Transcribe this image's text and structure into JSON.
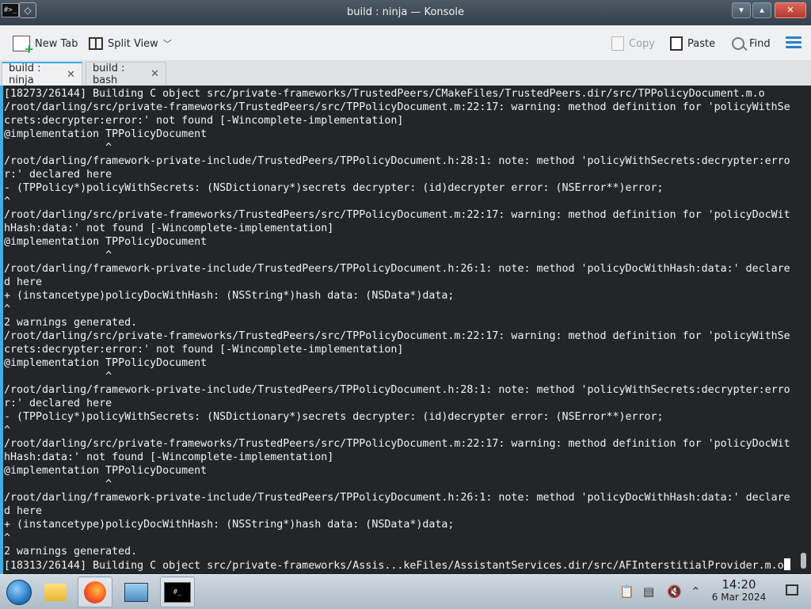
{
  "window": {
    "title": "build : ninja — Konsole",
    "app_icon_text": "#>_",
    "controls": {
      "minimize": "▾",
      "maximize": "▴",
      "close": "✕"
    }
  },
  "toolbar": {
    "new_tab": "New Tab",
    "split_view": "Split View",
    "copy": "Copy",
    "paste": "Paste",
    "find": "Find"
  },
  "tabs": [
    {
      "label": "build : ninja",
      "active": true
    },
    {
      "label": "build : bash",
      "active": false
    }
  ],
  "terminal": {
    "lines": [
      "[18273/26144] Building C object src/private-frameworks/TrustedPeers/CMakeFiles/TrustedPeers.dir/src/TPPolicyDocument.m.o",
      "/root/darling/src/private-frameworks/TrustedPeers/src/TPPolicyDocument.m:22:17: warning: method definition for 'policyWithSe",
      "crets:decrypter:error:' not found [-Wincomplete-implementation]",
      "@implementation TPPolicyDocument",
      "                ^",
      "/root/darling/framework-private-include/TrustedPeers/TPPolicyDocument.h:28:1: note: method 'policyWithSecrets:decrypter:erro",
      "r:' declared here",
      "- (TPPolicy*)policyWithSecrets: (NSDictionary*)secrets decrypter: (id)decrypter error: (NSError**)error;",
      "^",
      "/root/darling/src/private-frameworks/TrustedPeers/src/TPPolicyDocument.m:22:17: warning: method definition for 'policyDocWit",
      "hHash:data:' not found [-Wincomplete-implementation]",
      "@implementation TPPolicyDocument",
      "                ^",
      "/root/darling/framework-private-include/TrustedPeers/TPPolicyDocument.h:26:1: note: method 'policyDocWithHash:data:' declare",
      "d here",
      "+ (instancetype)policyDocWithHash: (NSString*)hash data: (NSData*)data;",
      "^",
      "2 warnings generated.",
      "/root/darling/src/private-frameworks/TrustedPeers/src/TPPolicyDocument.m:22:17: warning: method definition for 'policyWithSe",
      "crets:decrypter:error:' not found [-Wincomplete-implementation]",
      "@implementation TPPolicyDocument",
      "                ^",
      "/root/darling/framework-private-include/TrustedPeers/TPPolicyDocument.h:28:1: note: method 'policyWithSecrets:decrypter:erro",
      "r:' declared here",
      "- (TPPolicy*)policyWithSecrets: (NSDictionary*)secrets decrypter: (id)decrypter error: (NSError**)error;",
      "^",
      "/root/darling/src/private-frameworks/TrustedPeers/src/TPPolicyDocument.m:22:17: warning: method definition for 'policyDocWit",
      "hHash:data:' not found [-Wincomplete-implementation]",
      "@implementation TPPolicyDocument",
      "                ^",
      "/root/darling/framework-private-include/TrustedPeers/TPPolicyDocument.h:26:1: note: method 'policyDocWithHash:data:' declare",
      "d here",
      "+ (instancetype)policyDocWithHash: (NSString*)hash data: (NSData*)data;",
      "^",
      "2 warnings generated.",
      "[18313/26144] Building C object src/private-frameworks/Assis...keFiles/AssistantServices.dir/src/AFInterstitialProvider.m.o"
    ]
  },
  "taskbar": {
    "terminal_icon_text": "#_",
    "clock_time": "14:20",
    "clock_date": "6 Mar 2024"
  },
  "colors": {
    "terminal_bg": "#232629",
    "terminal_fg": "#f2f2f2",
    "accent": "#3daee9"
  }
}
